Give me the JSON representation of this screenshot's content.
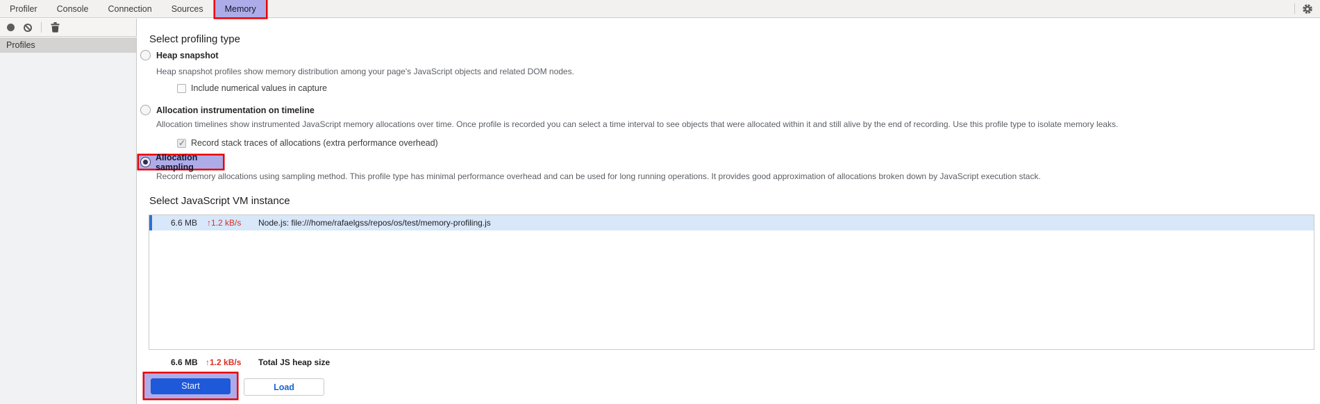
{
  "colors": {
    "annotation_red": "#e80000",
    "highlight_lavender": "#aeace8",
    "primary_blue": "#1d59d9",
    "rate_red": "#d93025",
    "row_selected_bg": "#d8e7f9",
    "row_selected_border": "#2e6fd6"
  },
  "tabbar": {
    "tabs": [
      {
        "label": "Profiler"
      },
      {
        "label": "Console"
      },
      {
        "label": "Connection"
      },
      {
        "label": "Sources"
      },
      {
        "label": "Memory"
      }
    ],
    "active_tab": "Memory"
  },
  "toolbar": {
    "record_icon": "record-icon",
    "clear_icon": "block-icon",
    "delete_icon": "trash-icon",
    "settings_icon": "gear-icon"
  },
  "sidebar": {
    "items": [
      {
        "label": "Profiles",
        "selected": true
      }
    ]
  },
  "profiling": {
    "heading": "Select profiling type",
    "options": [
      {
        "label": "Heap snapshot",
        "selected": false,
        "description": "Heap snapshot profiles show memory distribution among your page's JavaScript objects and related DOM nodes.",
        "checkbox": {
          "label": "Include numerical values in capture",
          "checked": false
        }
      },
      {
        "label": "Allocation instrumentation on timeline",
        "selected": false,
        "description": "Allocation timelines show instrumented JavaScript memory allocations over time. Once profile is recorded you can select a time interval to see objects that were allocated within it and still alive by the end of recording. Use this profile type to isolate memory leaks.",
        "checkbox": {
          "label": "Record stack traces of allocations (extra performance overhead)",
          "checked": true
        }
      },
      {
        "label": "Allocation sampling",
        "selected": true,
        "annotated": true,
        "description": "Record memory allocations using sampling method. This profile type has minimal performance overhead and can be used for long running operations. It provides good approximation of allocations broken down by JavaScript execution stack."
      }
    ]
  },
  "vm": {
    "heading": "Select JavaScript VM instance",
    "instances": [
      {
        "size": "6.6 MB",
        "rate": "↑1.2 kB/s",
        "name": "Node.js: file:///home/rafaelgss/repos/os/test/memory-profiling.js",
        "selected": true
      }
    ],
    "total": {
      "size": "6.6 MB",
      "rate": "↑1.2 kB/s",
      "label": "Total JS heap size"
    }
  },
  "actions": {
    "start_label": "Start",
    "load_label": "Load"
  }
}
